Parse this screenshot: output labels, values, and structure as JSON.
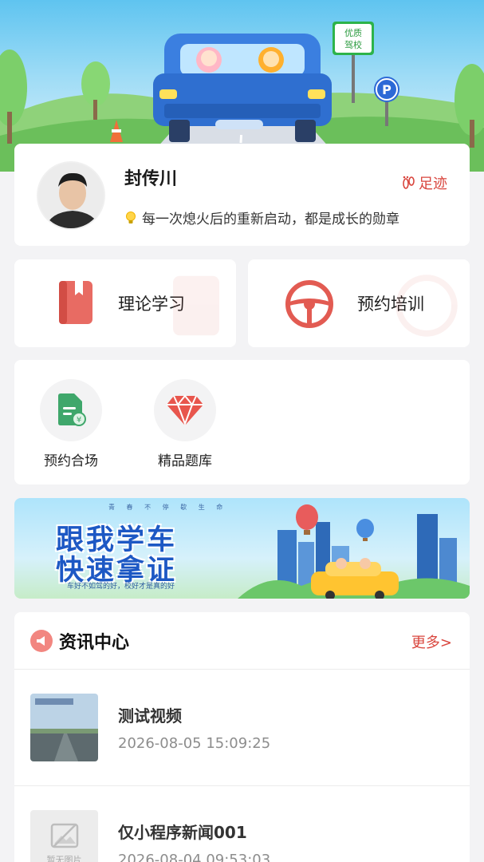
{
  "hero": {
    "sign_text": "优质驾校",
    "parking_letter": "P"
  },
  "profile": {
    "name": "封传川",
    "footprint_label": "足迹",
    "motto": "每一次熄火后的重新启动，都是成长的勋章"
  },
  "features": [
    {
      "label": "理论学习",
      "icon": "book-icon"
    },
    {
      "label": "预约培训",
      "icon": "steering-wheel-icon"
    }
  ],
  "services": [
    {
      "label": "预约合场",
      "icon": "document-coin-icon"
    },
    {
      "label": "精品题库",
      "icon": "diamond-icon"
    }
  ],
  "promo": {
    "headline_1": "跟我学车",
    "headline_2": "快速拿证",
    "top_line": "青 春 不 停 歇 生 命",
    "tagline": "车好不如驾的好，校好才是真的好"
  },
  "news": {
    "title": "资讯中心",
    "more_label": "更多>",
    "items": [
      {
        "title": "测试视频",
        "date": "2026-08-05 15:09:25"
      },
      {
        "title": "仅小程序新闻001",
        "date": "2026-08-04 09:53:03",
        "thumb_placeholder": "暂无图片"
      }
    ]
  },
  "colors": {
    "accent": "#d9463e",
    "promo_blue": "#1d58c4",
    "hero_sky": "#5fc4f0",
    "car_blue": "#3b7fe0"
  }
}
